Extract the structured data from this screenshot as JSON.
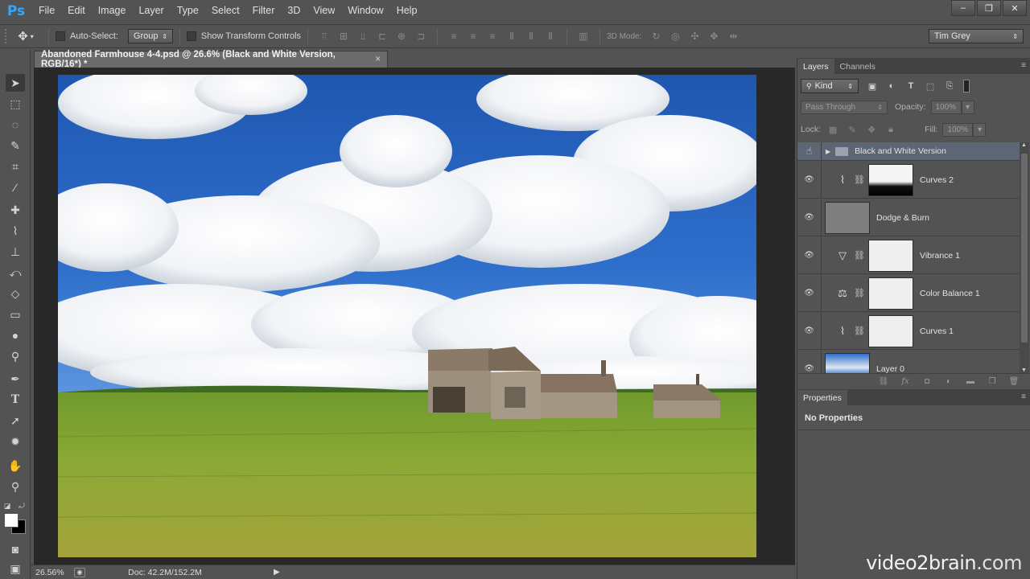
{
  "app": {
    "logo": "Ps",
    "menu": [
      "File",
      "Edit",
      "Image",
      "Layer",
      "Type",
      "Select",
      "Filter",
      "3D",
      "View",
      "Window",
      "Help"
    ],
    "window_controls": [
      "–",
      "❐",
      "✕"
    ]
  },
  "options_bar": {
    "auto_select_label": "Auto-Select:",
    "auto_select_value": "Group",
    "show_transform_label": "Show Transform Controls",
    "mode_3d_label": "3D Mode:",
    "workspace_value": "Tim Grey"
  },
  "document": {
    "tab_title": "Abandoned Farmhouse 4-4.psd @ 26.6% (Black and White Version, RGB/16*) *",
    "close_glyph": "×"
  },
  "status": {
    "zoom": "26.56%",
    "doc_info": "Doc: 42.2M/152.2M"
  },
  "layers_panel": {
    "tabs": [
      "Layers",
      "Channels"
    ],
    "filter_kind": "Kind",
    "blend_mode": "Pass Through",
    "opacity_label": "Opacity:",
    "opacity_value": "100%",
    "lock_label": "Lock:",
    "fill_label": "Fill:",
    "fill_value": "100%",
    "layers": [
      {
        "name": "Black and White Version",
        "type": "group",
        "selected": true
      },
      {
        "name": "Curves 2",
        "type": "curves"
      },
      {
        "name": "Dodge & Burn",
        "type": "pixel"
      },
      {
        "name": "Vibrance 1",
        "type": "vibrance"
      },
      {
        "name": "Color Balance 1",
        "type": "color-balance"
      },
      {
        "name": "Curves 1",
        "type": "curves"
      },
      {
        "name": "Layer 0",
        "type": "image"
      }
    ]
  },
  "properties_panel": {
    "tab": "Properties",
    "message": "No Properties"
  },
  "watermark": {
    "text_main": "video2brain",
    "text_dot": ".com"
  }
}
